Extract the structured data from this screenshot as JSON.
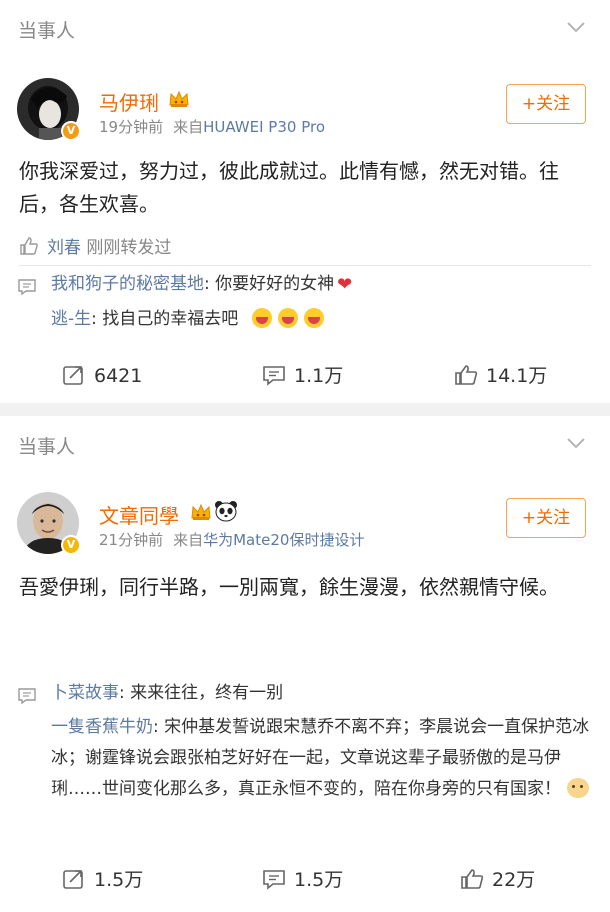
{
  "posts": [
    {
      "label": "当事人",
      "username": "马伊琍",
      "time": "19分钟前",
      "source_prefix": "来自",
      "source": "HUAWEI P30 Pro",
      "follow_label": "+关注",
      "text": "你我深爱过，努力过，彼此成就过。此情有憾，然无对错。往后，各生欢喜。",
      "repost": {
        "name": "刘春",
        "text": "刚刚转发过"
      },
      "comments": [
        {
          "user": "我和狗子的秘密基地",
          "sep": ": ",
          "text": "你要好好的女神"
        },
        {
          "user": "逃-生",
          "sep": ": ",
          "text": "找自己的幸福去吧"
        }
      ],
      "stats": {
        "reposts": "6421",
        "comments": "1.1万",
        "likes": "14.1万"
      }
    },
    {
      "label": "当事人",
      "username": "文章同學",
      "time": "21分钟前",
      "source_prefix": "来自",
      "source": "华为Mate20保时捷设计",
      "follow_label": "+关注",
      "text": "吾愛伊琍，同行半路，一別兩寬，餘生漫漫，依然親情守候。",
      "comments": [
        {
          "user": "卜菜故事",
          "sep": ": ",
          "text": "来来往往，终有一别"
        },
        {
          "user": "一隻香蕉牛奶",
          "sep": ": ",
          "text": "宋仲基发誓说跟宋慧乔不离不弃；李晨说会一直保护范冰冰；谢霆锋说会跟张柏芝好好在一起，文章说这辈子最骄傲的是马伊琍……世间变化那么多，真正永恒不变的，陪在你身旁的只有国家！"
        }
      ],
      "stats": {
        "reposts": "1.5万",
        "comments": "1.5万",
        "likes": "22万"
      }
    }
  ],
  "colors": {
    "accent": "#f26a00",
    "link": "#5d7aa3",
    "muted": "#888888",
    "background": "#f1f1f1"
  },
  "icons": [
    "chevron-down-icon",
    "crown-icon",
    "panda-icon",
    "verified-icon",
    "like-icon",
    "comment-icon",
    "repost-icon",
    "heart-icon",
    "emoji-icon"
  ]
}
